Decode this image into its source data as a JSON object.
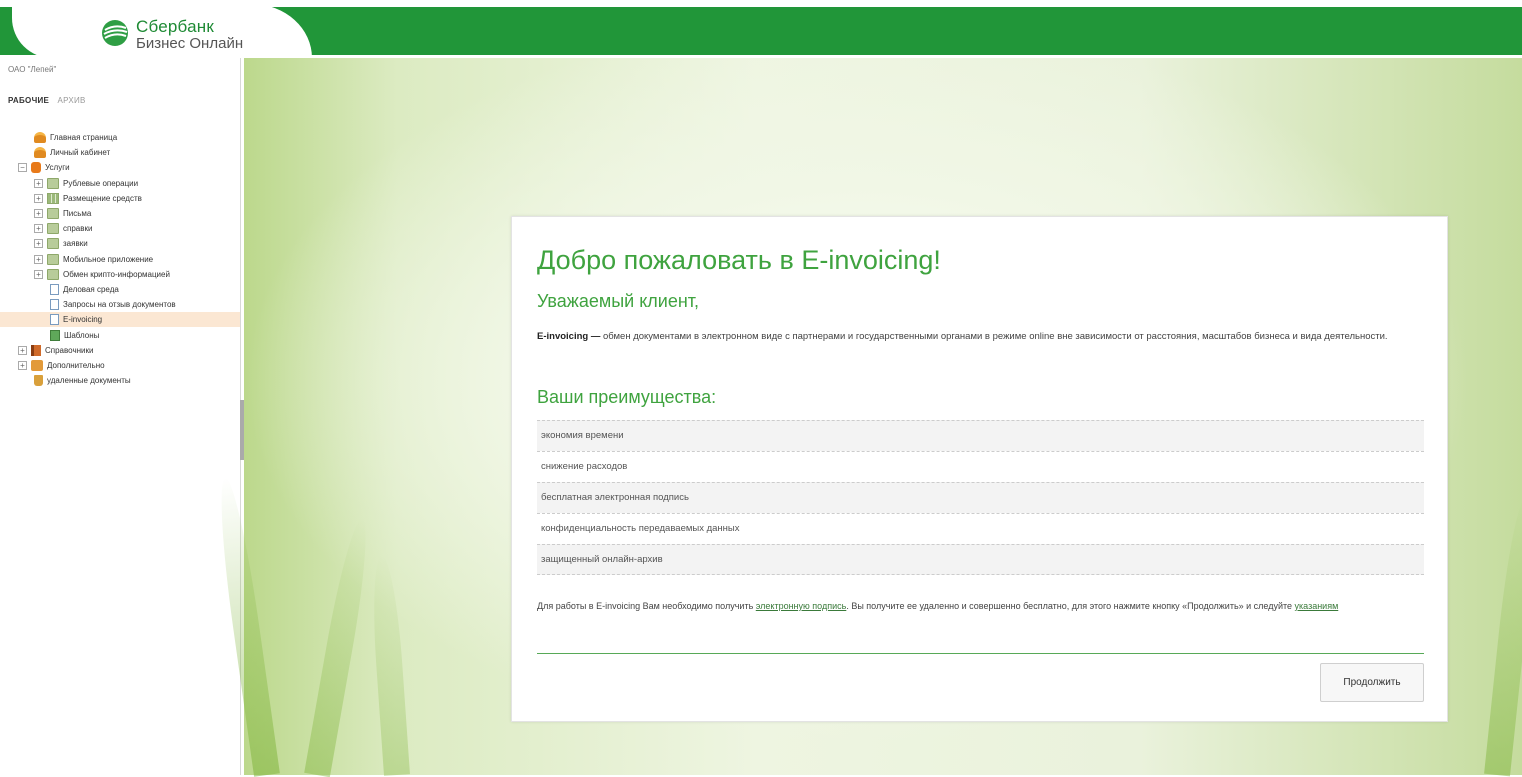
{
  "brand": {
    "line1": "Сбербанк",
    "line2": "Бизнес Онлайн"
  },
  "sidebar": {
    "org": "ОАО \"Лепей\"",
    "tab_active": "РАБОЧИЕ",
    "tab_archive": "АРХИВ",
    "items": [
      {
        "label": "Главная страница"
      },
      {
        "label": "Личный кабинет"
      },
      {
        "label": "Услуги"
      },
      {
        "label": "Рублевые операции"
      },
      {
        "label": "Размещение средств"
      },
      {
        "label": "Письма"
      },
      {
        "label": "справки"
      },
      {
        "label": "заявки"
      },
      {
        "label": "Мобильное приложение"
      },
      {
        "label": "Обмен крипто-информацией"
      },
      {
        "label": "Деловая среда"
      },
      {
        "label": "Запросы на отзыв документов"
      },
      {
        "label": "E-invoicing"
      },
      {
        "label": "Шаблоны"
      },
      {
        "label": "Справочники"
      },
      {
        "label": "Дополнительно"
      },
      {
        "label": "удаленные документы"
      }
    ]
  },
  "card": {
    "title": "Добро пожаловать в E-invoicing!",
    "subtitle": "Уважаемый клиент,",
    "intro_bold": "E-invoicing —",
    "intro_text": " обмен документами в электронном виде с партнерами и государственными органами в режиме online вне зависимости от расстояния, масштабов бизнеса и вида деятельности.",
    "advantages_title": "Ваши преимущества:",
    "advantages": [
      "экономия времени",
      "снижение расходов",
      "бесплатная электронная подпись",
      "конфиденциальность передаваемых данных",
      "защищенный онлайн-архив"
    ],
    "note_part1": "Для работы в E-invoicing Вам необходимо получить ",
    "note_link1": "электронную подпись",
    "note_part2": ". Вы получите ее удаленно и совершенно бесплатно, для этого нажмите кнопку «Продолжить» и следуйте ",
    "note_link2": "указаниям",
    "continue_label": "Продолжить"
  },
  "colors": {
    "header_green": "#219639",
    "accent_green": "#3fa33f",
    "selected_row": "#fbe7d3"
  }
}
